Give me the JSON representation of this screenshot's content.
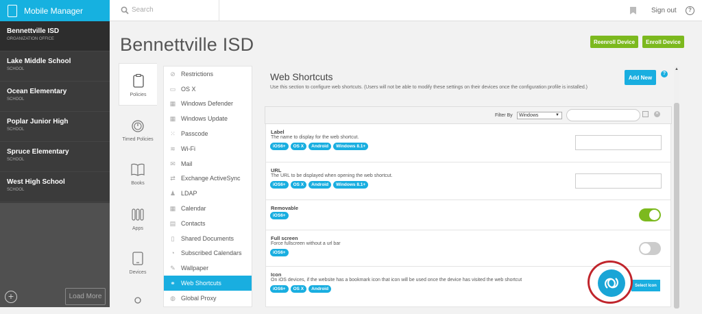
{
  "app": {
    "title": "Mobile Manager"
  },
  "sidebar": {
    "orgs": [
      {
        "name": "Bennettville ISD",
        "sub": "ORGANIZATION OFFICE"
      },
      {
        "name": "Lake Middle School",
        "sub": "SCHOOL"
      },
      {
        "name": "Ocean Elementary",
        "sub": "SCHOOL"
      },
      {
        "name": "Poplar Junior High",
        "sub": "SCHOOL"
      },
      {
        "name": "Spruce Elementary",
        "sub": "SCHOOL"
      },
      {
        "name": "West High School",
        "sub": "SCHOOL"
      }
    ],
    "load_more": "Load More",
    "add": "+"
  },
  "topbar": {
    "search_placeholder": "Search",
    "sign_out": "Sign out",
    "help": "?"
  },
  "header": {
    "title": "Bennettville ISD",
    "reenroll": "Reenroll Device",
    "enroll": "Enroll Device"
  },
  "categories": [
    {
      "label": "Policies"
    },
    {
      "label": "Timed Policies"
    },
    {
      "label": "Books"
    },
    {
      "label": "Apps"
    },
    {
      "label": "Devices"
    }
  ],
  "menu": [
    {
      "label": "Restrictions",
      "icon": "ban-icon"
    },
    {
      "label": "OS X",
      "icon": "monitor-icon"
    },
    {
      "label": "Windows Defender",
      "icon": "grid-icon"
    },
    {
      "label": "Windows Update",
      "icon": "grid-icon"
    },
    {
      "label": "Passcode",
      "icon": "keypad-icon"
    },
    {
      "label": "Wi-Fi",
      "icon": "wifi-icon"
    },
    {
      "label": "Mail",
      "icon": "mail-icon"
    },
    {
      "label": "Exchange ActiveSync",
      "icon": "sync-icon"
    },
    {
      "label": "LDAP",
      "icon": "person-icon"
    },
    {
      "label": "Calendar",
      "icon": "calendar-icon"
    },
    {
      "label": "Contacts",
      "icon": "contacts-icon"
    },
    {
      "label": "Shared Documents",
      "icon": "document-icon"
    },
    {
      "label": "Subscribed Calendars",
      "icon": "rss-icon"
    },
    {
      "label": "Wallpaper",
      "icon": "brush-icon"
    },
    {
      "label": "Web Shortcuts",
      "icon": "link-icon",
      "active": true
    },
    {
      "label": "Global Proxy",
      "icon": "globe-icon"
    }
  ],
  "content": {
    "title": "Web Shortcuts",
    "description": "Use this section to configure web shortcuts. (Users will not be able to modify these settings on their devices once the configuration profile is installed.)",
    "add_new": "Add New",
    "help": "?",
    "filter_label": "Filter By",
    "filter_value": "Windows",
    "fields": [
      {
        "label": "Label",
        "desc": "The name to display for the web shortcut.",
        "tags": [
          "iOS6+",
          "OS X",
          "Android",
          "Windows 8.1+"
        ],
        "control": "input"
      },
      {
        "label": "URL",
        "desc": "The URL to be displayed when opening the web shortcut.",
        "tags": [
          "iOS6+",
          "OS X",
          "Android",
          "Windows 8.1+"
        ],
        "control": "input"
      },
      {
        "label": "Removable",
        "desc": "",
        "tags": [
          "iOS6+"
        ],
        "control": "toggle",
        "on": true
      },
      {
        "label": "Full screen",
        "desc": "Force fullscreen without a url bar",
        "tags": [
          "iOS6+"
        ],
        "control": "toggle",
        "on": false
      },
      {
        "label": "Icon",
        "desc": "On iOS devices, if the website has a bookmark icon that icon will be used once the device has visited the web shortcut",
        "tags": [
          "iOS6+",
          "OS X",
          "Android"
        ],
        "control": "icon",
        "button": "Select Icon"
      }
    ]
  },
  "colors": {
    "brand": "#16b1e0",
    "accent": "#19aee0",
    "green": "#7cb91e",
    "highlight": "#c0252c"
  }
}
